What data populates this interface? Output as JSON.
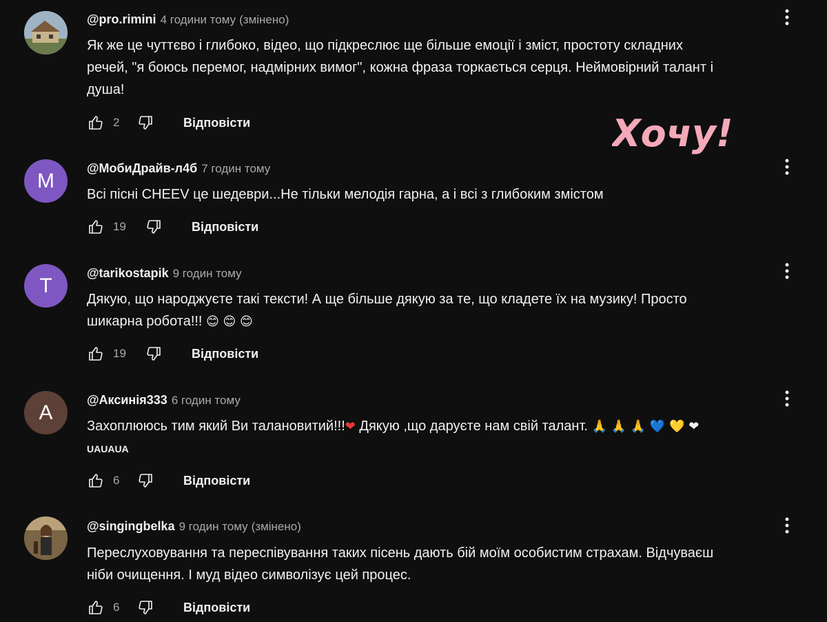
{
  "reply_label": "Відповісти",
  "watermark_text": "Хочу!",
  "colors": {
    "background": "#0f0f0f",
    "text": "#f1f1f1",
    "secondary": "#aaaaaa",
    "avatar_m": "#7e57c2",
    "avatar_t": "#7e57c2",
    "avatar_a": "#5d4037",
    "watermark": "#f4a9b8"
  },
  "comments": [
    {
      "author": "@pro.rimini",
      "time": "4 години тому",
      "edited": "(змінено)",
      "text_lines": [
        "Як же це чуттєво і глибоко, відео, що підкреслює ще більше емоції і зміст, простоту складних",
        "речей, \"я боюсь перемог, надмірних вимог\", кожна фраза торкається серця. Неймовірний талант і",
        "душа!"
      ],
      "likes": "2",
      "avatar_icon": "house-photo-icon"
    },
    {
      "author": "@МобиДрайв-л4б",
      "time": "7 годин тому",
      "text_lines": [
        "Всі пісні CHEEV це шедеври...Не тільки мелодія гарна, а і всі з глибоким змістом"
      ],
      "likes": "19",
      "avatar_letter": "M"
    },
    {
      "author": "@tarikostapik",
      "time": "9 годин тому",
      "text_lines": [
        "Дякую, що народжуєте такі тексти! А ще більше дякую за те, що кладете їх на музику! Просто",
        "шикарна робота!!!"
      ],
      "emojis": "😊 😊 😊",
      "likes": "19",
      "avatar_letter": "T"
    },
    {
      "author": "@Аксинія333",
      "time": "6 годин тому",
      "text_lines": [
        "Захоплююсь тим який  Ви талановитий!!!"
      ],
      "text_tail": " Дякую ,що даруєте нам свій талант.",
      "heart": "❤",
      "tail_emojis": "🙏 🙏 🙏 💙 💛 ❤",
      "extra": "UAUAUA",
      "likes": "6",
      "avatar_letter": "A"
    },
    {
      "author": "@singingbelka",
      "time": "9 годин тому",
      "edited": "(змінено)",
      "text_lines": [
        "Переслуховування та переспівування таких пісень дають бій моїм особистим страхам. Відчуваєш",
        "ніби очищення. І муд відео символізує цей процес."
      ],
      "likes": "6",
      "avatar_icon": "singer-photo-icon"
    }
  ]
}
